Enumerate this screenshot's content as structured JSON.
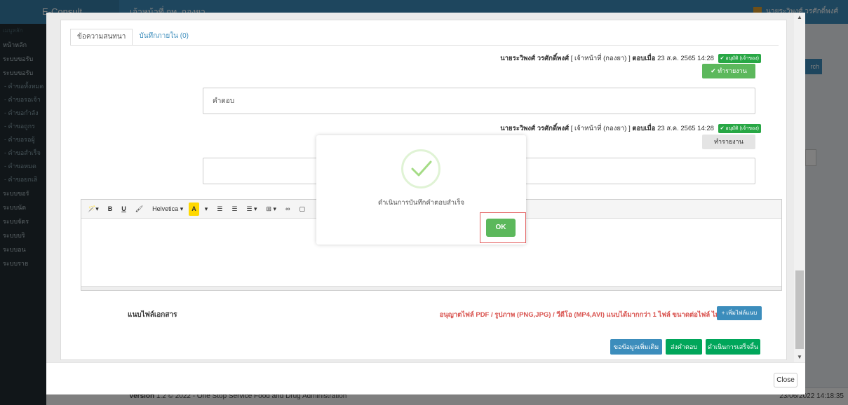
{
  "app": {
    "brand": "E-Consult",
    "department": "เจ้าหน้าที่ กท. กองยา",
    "user": "นายระวิพงศ์ วรศักดิ์พงศ์",
    "version_label": "Version",
    "version_text": "1.2 © 2022 - One Stop Service Food and Drug Administration",
    "timestamp": "23/06/2022 14:18:35"
  },
  "sidebar": {
    "items": [
      {
        "label": "เมนูหลัก",
        "type": "head"
      },
      {
        "label": "หน้าหลัก",
        "type": "item"
      },
      {
        "label": "ระบบขอรับ",
        "type": "item"
      },
      {
        "label": "ระบบขอรับ",
        "type": "item"
      },
      {
        "label": "- คำขอทั้งหมด",
        "type": "sub"
      },
      {
        "label": "- คำขอรอเจ้า",
        "type": "sub"
      },
      {
        "label": "- คำขอกำลัง",
        "type": "sub"
      },
      {
        "label": "- คำขอถูกร",
        "type": "sub"
      },
      {
        "label": "- คำขอรอผู้",
        "type": "sub"
      },
      {
        "label": "- คำขอสำเร็จ",
        "type": "sub"
      },
      {
        "label": "- คำขอหมด",
        "type": "sub"
      },
      {
        "label": "- คำขอยกเลิ",
        "type": "sub"
      },
      {
        "label": "ระบบขอรั",
        "type": "item"
      },
      {
        "label": "ระบบนัด",
        "type": "item"
      },
      {
        "label": "ระบบจัดร",
        "type": "item"
      },
      {
        "label": "ระบบบริ",
        "type": "item"
      },
      {
        "label": "ระบบอน",
        "type": "item"
      },
      {
        "label": "ระบบราย",
        "type": "item"
      }
    ]
  },
  "background": {
    "right_button": "rch"
  },
  "modal": {
    "tabs": [
      {
        "label": "ข้อความสนทนา",
        "active": true
      },
      {
        "label": "บันทึกภายใน (0)",
        "active": false
      }
    ],
    "messages": [
      {
        "author": "นายระวิพงศ์ วรศักดิ์พงศ์",
        "role": "[ เจ้าหน้าที่ (กองยา) ]",
        "answered_label": "ตอบเมื่อ",
        "datetime": "23 ส.ค. 2565 14:28",
        "badge": "✔ อนุมัติ (เจ้าของ)",
        "report_button": "✔ ทำรายงาน",
        "body": "คำตอบ"
      },
      {
        "author": "นายระวิพงศ์ วรศักดิ์พงศ์",
        "role": "[ เจ้าหน้าที่ (กองยา) ]",
        "answered_label": "ตอบเมื่อ",
        "datetime": "23 ส.ค. 2565 14:28",
        "badge": "✔ อนุมัติ (เจ้าของ)",
        "report_button": "ทำรายงาน",
        "body": ""
      }
    ],
    "editor_toolbar": {
      "magic": "🪄▾",
      "bold": "B",
      "underline": "U",
      "eraser": "🖌",
      "font": "Helvetica ▾",
      "color": "A",
      "color_caret": "▾",
      "ul": "☰",
      "ol": "☰",
      "align": "☰ ▾",
      "table": "⊞ ▾",
      "link": "∞",
      "picture": "▢"
    },
    "attach_label": "แนบไฟล์เอกสาร",
    "attach_note": "อนุญาตไฟล์ PDF / รูปภาพ (PNG,JPG) / วีดีโอ (MP4,AVI) แนบได้มากกว่า 1 ไฟล์ ขนาดต่อไฟล์ ไม่เกิน 50 MB",
    "add_file_button": "+ เพิ่มไฟล์แนบ",
    "buttons": {
      "request_more": "ขอข้อมูลเพิ่มเติม",
      "send_answer": "ส่งคำตอบ",
      "finish": "ดำเนินการเสร็จสิ้น"
    },
    "close_button": "Close"
  },
  "dialog": {
    "message": "ดำเนินการบันทึกคำตอบสำเร็จ",
    "ok_button": "OK",
    "icon": "success-check-icon",
    "accent": "#a5dc86"
  }
}
